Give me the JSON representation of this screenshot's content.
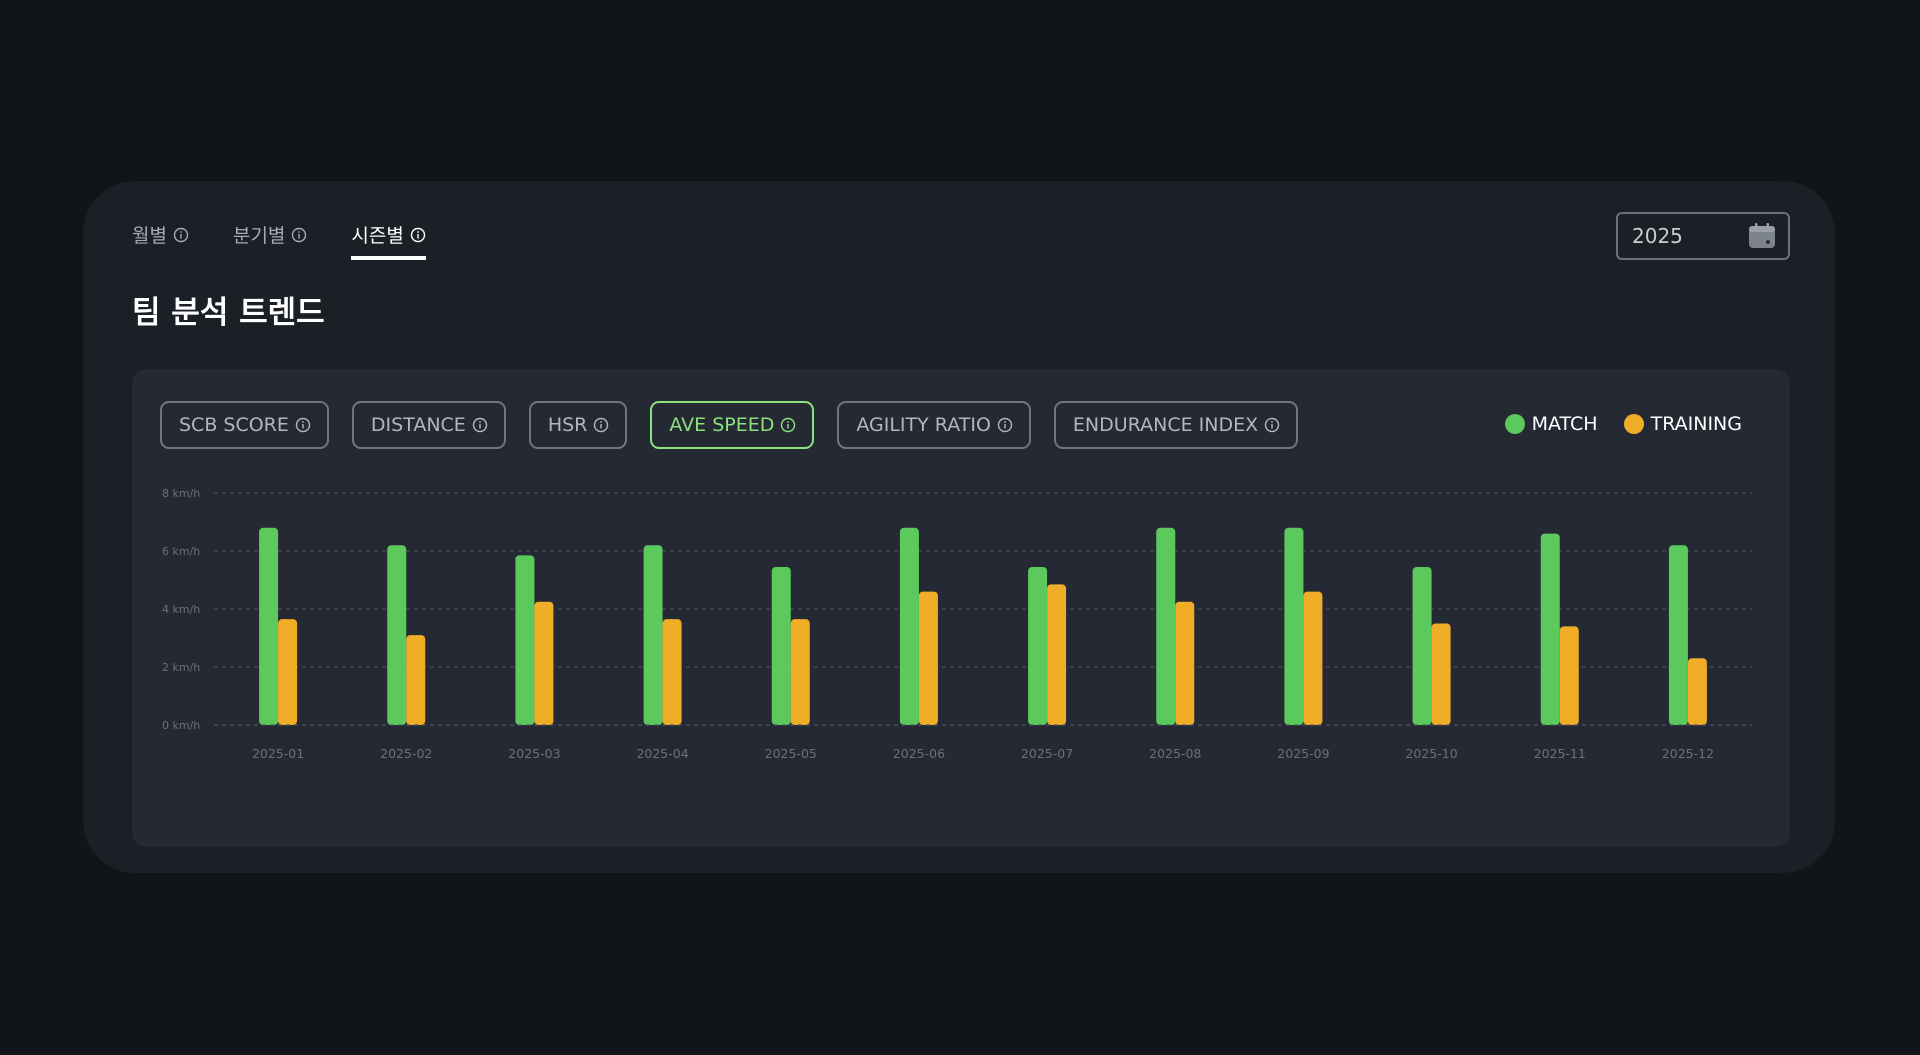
{
  "tabs": [
    {
      "label": "월별",
      "active": false
    },
    {
      "label": "분기별",
      "active": false
    },
    {
      "label": "시즌별",
      "active": true
    }
  ],
  "title": "팀 분석 트렌드",
  "year_picker": {
    "value": "2025",
    "icon": "calendar-icon"
  },
  "metric_chips": [
    {
      "label": "SCB SCORE",
      "active": false
    },
    {
      "label": "DISTANCE",
      "active": false
    },
    {
      "label": "HSR",
      "active": false
    },
    {
      "label": "AVE SPEED",
      "active": true
    },
    {
      "label": "AGILITY RATIO",
      "active": false
    },
    {
      "label": "ENDURANCE INDEX",
      "active": false
    }
  ],
  "colors": {
    "match": "#5cc95c",
    "training": "#f0ad27",
    "active_chip": "#8ee07f",
    "grid": "#4f5560",
    "tick_text": "#6b7079"
  },
  "legend": [
    {
      "label": "MATCH",
      "color": "#5cc95c"
    },
    {
      "label": "TRAINING",
      "color": "#f0ad27"
    }
  ],
  "chart_data": {
    "type": "bar",
    "categories": [
      "2025-01",
      "2025-02",
      "2025-03",
      "2025-04",
      "2025-05",
      "2025-06",
      "2025-07",
      "2025-08",
      "2025-09",
      "2025-10",
      "2025-11",
      "2025-12"
    ],
    "series": [
      {
        "name": "MATCH",
        "values": [
          6.8,
          6.2,
          5.85,
          6.2,
          5.45,
          6.8,
          5.45,
          6.8,
          6.8,
          5.45,
          6.6,
          6.2
        ]
      },
      {
        "name": "TRAINING",
        "values": [
          3.65,
          3.1,
          4.25,
          3.65,
          3.65,
          4.6,
          4.85,
          4.25,
          4.6,
          3.5,
          3.4,
          2.3
        ]
      }
    ],
    "y_ticks": [
      "0 km/h",
      "2 km/h",
      "4 km/h",
      "6 km/h",
      "8 km/h"
    ],
    "ylim": [
      0,
      8
    ],
    "grid": true,
    "legend_position": "top-right"
  }
}
